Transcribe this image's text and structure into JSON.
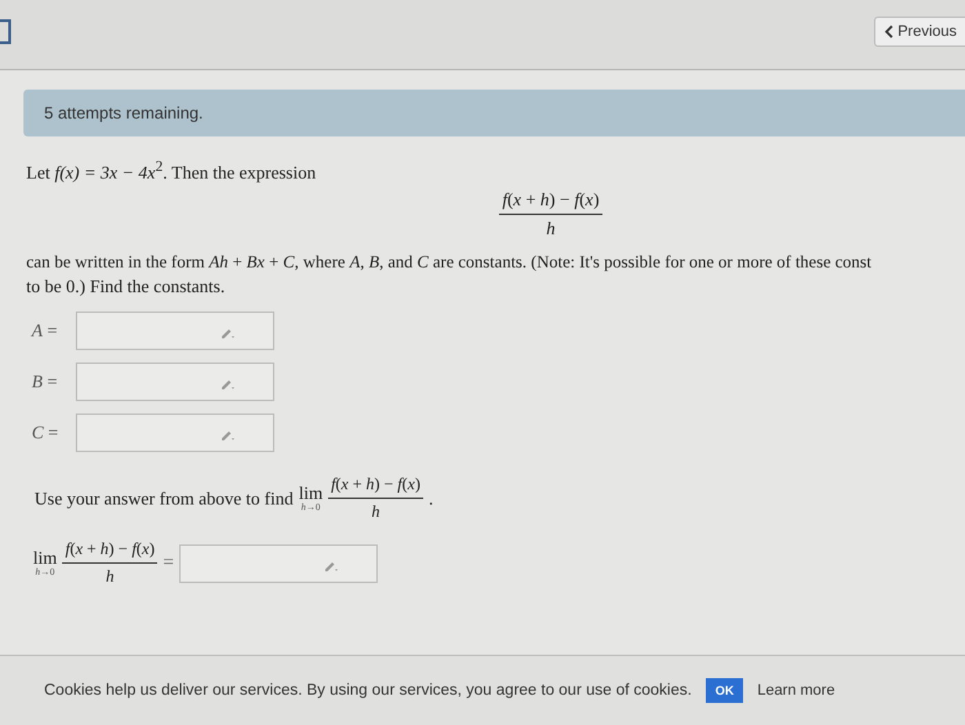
{
  "nav": {
    "previous_label": "Previous"
  },
  "alert": {
    "text": "5 attempts remaining."
  },
  "problem": {
    "intro": [
      {
        "kind": "text",
        "text": "Let "
      },
      {
        "kind": "math",
        "text": "f(x) = 3x − 4x"
      },
      {
        "kind": "sup",
        "text": "2"
      },
      {
        "kind": "text",
        "text": ". Then the expression"
      }
    ],
    "fraction": {
      "numerator": "*f*(*x* + *h*) − *f*(*x*)",
      "denominator": "*h*"
    },
    "statement": "can be written in the form *Ah* + *Bx* + *C*, where *A*, *B*, and *C* are constants. (Note: It's possible for one or more of these const",
    "statement_end": "to be 0.) Find the constants.",
    "answers": [
      {
        "label": "*A* ="
      },
      {
        "label": "*B* ="
      },
      {
        "label": "*C* ="
      }
    ],
    "limit_prompt": "Use your answer from above to find",
    "limit": {
      "word": "lim",
      "sub": "*h*→0",
      "numerator": "*f*(*x* + *h*) − *f*(*x*)",
      "denominator": "*h*",
      "end": "."
    },
    "limit_answer": {
      "word": "lim",
      "sub": "*h*→0",
      "numerator": "*f*(*x* + *h*) − *f*(*x*)",
      "denominator": "*h*",
      "equals": "="
    }
  },
  "cookie_bar": {
    "text": "Cookies help us deliver our services. By using our services, you agree to our use of cookies.",
    "ok_label": "OK",
    "learn_more": "Learn more"
  }
}
